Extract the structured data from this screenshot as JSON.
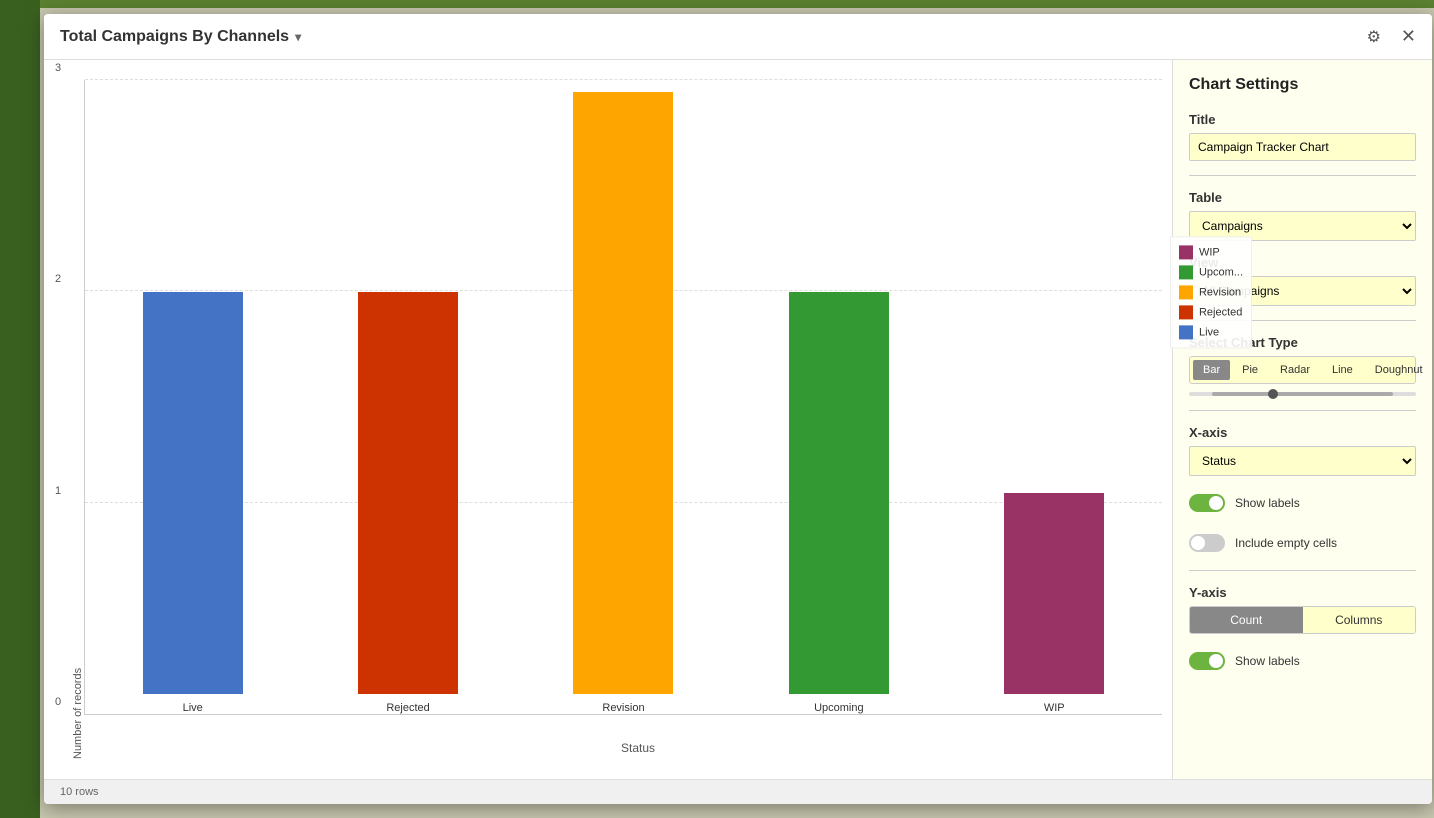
{
  "title": "Total Campaigns By Channels",
  "modal": {
    "title": "Total Campaigns By Channels"
  },
  "chart": {
    "yAxisLabel": "Number of records",
    "xAxisLabel": "Status",
    "yTicks": [
      "0",
      "1",
      "2",
      "3"
    ],
    "bars": [
      {
        "label": "Live",
        "value": 2,
        "maxValue": 3,
        "color": "#4472C4"
      },
      {
        "label": "Rejected",
        "value": 2,
        "maxValue": 3,
        "color": "#CC3300"
      },
      {
        "label": "Revision",
        "value": 3,
        "maxValue": 3,
        "color": "#FFA500"
      },
      {
        "label": "Upcoming",
        "value": 2,
        "maxValue": 3,
        "color": "#339933"
      },
      {
        "label": "WIP",
        "value": 1,
        "maxValue": 3,
        "color": "#993366"
      }
    ],
    "legend": [
      {
        "label": "WIP",
        "color": "#993366"
      },
      {
        "label": "Upcom...",
        "color": "#339933"
      },
      {
        "label": "Revision",
        "color": "#FFA500"
      },
      {
        "label": "Rejected",
        "color": "#CC3300"
      },
      {
        "label": "Live",
        "color": "#4472C4"
      }
    ]
  },
  "settings": {
    "panelTitle": "Chart Settings",
    "titleLabel": "Title",
    "titleValue": "Campaign Tracker Chart",
    "tableLabel": "Table",
    "tableValue": "Campaigns",
    "tableOptions": [
      "Campaigns"
    ],
    "viewLabel": "View",
    "viewValue": "All Campaigns",
    "viewOptions": [
      "All Campaigns"
    ],
    "chartTypeLabel": "Select Chart Type",
    "chartTypes": [
      "Bar",
      "Pie",
      "Radar",
      "Line",
      "Doughnut"
    ],
    "activeChartType": "Bar",
    "xAxisLabel": "X-axis",
    "xAxisValue": "Status",
    "xAxisOptions": [
      "Status"
    ],
    "showLabels": true,
    "showLabelsText": "Show labels",
    "includeEmptyCells": false,
    "includeEmptyText": "Include empty cells",
    "yAxisLabel": "Y-axis",
    "yAxisCount": "Count",
    "yAxisColumns": "Columns",
    "yAxisShowLabels": true,
    "yAxisShowLabelsText": "Show labels"
  },
  "footer": {
    "rowCount": "10 rows"
  }
}
